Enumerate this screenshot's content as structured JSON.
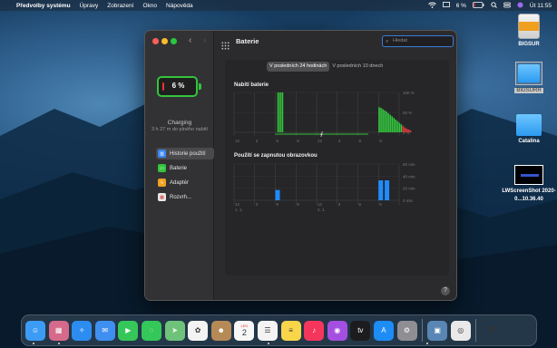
{
  "menubar": {
    "apple": "",
    "app": "Předvolby systému",
    "items": [
      "Úpravy",
      "Zobrazení",
      "Okno",
      "Nápověda"
    ],
    "battery_pct": "6 %",
    "time": "Út 11:55"
  },
  "desktop_icons": [
    {
      "label": "BIGSUR",
      "icon": "drive-icon"
    },
    {
      "label": "BIGSURR",
      "icon": "folder-icon"
    },
    {
      "label": "Catalina",
      "icon": "folder-icon"
    },
    {
      "label": "LWScreenShot 2020-0...10.36.40",
      "icon": "screenshot-thumbnail"
    }
  ],
  "window": {
    "title": "Baterie",
    "search_placeholder": "Hledat",
    "battery_level": "6 %",
    "battery_fraction": 0.06,
    "status": "Charging",
    "time_to_full": "3 h 27 m do plného nabití",
    "sidebar": [
      {
        "label": "Historie použití",
        "icon": "usage-history-icon",
        "color": "#3a86f0",
        "selected": true
      },
      {
        "label": "Baterie",
        "icon": "battery-icon",
        "color": "#33c43d",
        "selected": false
      },
      {
        "label": "Adaptér",
        "icon": "power-adapter-icon",
        "color": "#f2a122",
        "selected": false
      },
      {
        "label": "Rozvrh...",
        "icon": "calendar-icon",
        "color": "#e8e8e8",
        "selected": false
      }
    ],
    "tabs": [
      {
        "label": "V posledních 24 hodinách",
        "active": true
      },
      {
        "label": "V posledních 10 dnech",
        "active": false
      }
    ],
    "charge_chart_title": "Nabití baterie",
    "screen_chart_title": "Použití se zapnutou obrazovkou",
    "help": "?"
  },
  "chart_data": [
    {
      "type": "bar",
      "title": "Nabití baterie",
      "y_tick_labels": [
        "100 %",
        "50 %",
        "0 %"
      ],
      "ylim": [
        0,
        100
      ],
      "x_tick_labels": [
        "12",
        "3",
        "6",
        "9",
        "12",
        "3",
        "6",
        "9"
      ],
      "segments": [
        {
          "x_start": 2.1,
          "x_end": 2.4,
          "values": [
            100,
            100,
            100,
            100
          ]
        },
        {
          "x_start": 7.0,
          "x_end": 8.6,
          "values": [
            63,
            61,
            58,
            55,
            52,
            48,
            44,
            40,
            36,
            32,
            28,
            24,
            20,
            16,
            12,
            9,
            7,
            5
          ]
        }
      ],
      "charging_line": {
        "x_start": 2.0,
        "x_end": 6.5
      },
      "colors": {
        "high": "#33c43d",
        "low": "#e33b3b"
      }
    },
    {
      "type": "bar",
      "title": "Použití se zapnutou obrazovkou",
      "y_tick_labels": [
        "60 min",
        "40 min",
        "20 min",
        "0 min"
      ],
      "ylim": [
        0,
        60
      ],
      "x_tick_labels": [
        "12",
        "3",
        "6",
        "9",
        "12",
        "3",
        "6",
        "9"
      ],
      "x_sub_labels": [
        "1. 1.",
        "2. 1."
      ],
      "x": [
        2,
        7,
        7.3
      ],
      "values": [
        17,
        33,
        33
      ],
      "color": "#1f8bff"
    }
  ],
  "dock": [
    {
      "name": "finder-icon",
      "color": "#3c9cf5",
      "glyph": "☺"
    },
    {
      "name": "launchpad-icon",
      "color": "#d56a8a",
      "glyph": "▦"
    },
    {
      "name": "safari-icon",
      "color": "#2d8cf0",
      "glyph": "✧"
    },
    {
      "name": "mail-icon",
      "color": "#3f8ff0",
      "glyph": "✉"
    },
    {
      "name": "facetime-icon",
      "color": "#35c759",
      "glyph": "▶"
    },
    {
      "name": "messages-icon",
      "color": "#34c759",
      "glyph": "◌"
    },
    {
      "name": "maps-icon",
      "color": "#6fc27a",
      "glyph": "➤"
    },
    {
      "name": "photos-icon",
      "color": "#f3f3f3",
      "glyph": "✿"
    },
    {
      "name": "contacts-icon",
      "color": "#b58a57",
      "glyph": "☻"
    },
    {
      "name": "calendar-icon",
      "color": "#f7f7f7",
      "glyph": "2"
    },
    {
      "name": "reminders-icon",
      "color": "#f4f4f4",
      "glyph": "☰"
    },
    {
      "name": "notes-icon",
      "color": "#f9d54a",
      "glyph": "≡"
    },
    {
      "name": "music-icon",
      "color": "#f5365c",
      "glyph": "♪"
    },
    {
      "name": "podcasts-icon",
      "color": "#a54fe0",
      "glyph": "◉"
    },
    {
      "name": "appletv-icon",
      "color": "#1c1c1e",
      "glyph": "tv"
    },
    {
      "name": "appstore-icon",
      "color": "#1d8cf5",
      "glyph": "A"
    },
    {
      "name": "system-preferences-icon",
      "color": "#8e8e93",
      "glyph": "⚙"
    },
    {
      "name": "preview-icon",
      "color": "#5a86b5",
      "glyph": "▣"
    },
    {
      "name": "chrome-icon",
      "color": "#e9e9e9",
      "glyph": "◎"
    },
    {
      "name": "trash-icon",
      "color": "#c7c7cc",
      "glyph": "🗑"
    }
  ],
  "dock_calendar": {
    "month": "LED",
    "day": "2"
  }
}
